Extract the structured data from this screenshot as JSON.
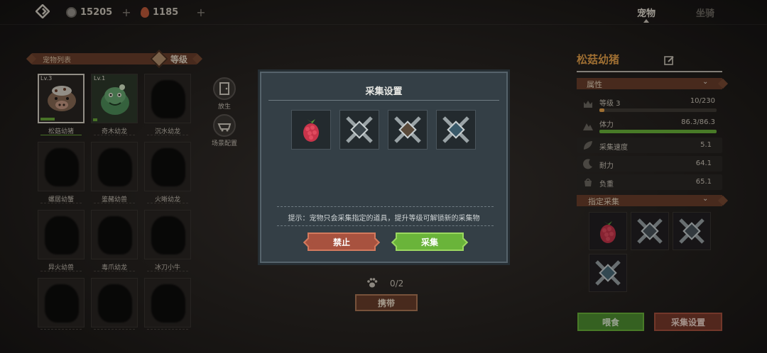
{
  "topbar": {
    "coins": "15205",
    "gems": "1185",
    "tabs": [
      {
        "label": "宠物",
        "active": true
      },
      {
        "label": "坐骑",
        "active": false
      }
    ]
  },
  "pet_list": {
    "title": "宠物列表",
    "sort_label": "等级",
    "pets": [
      {
        "name": "松菇幼猪",
        "level": "Lv.3",
        "selected": true,
        "known": true
      },
      {
        "name": "奇木幼龙",
        "level": "Lv.1",
        "selected": false,
        "known": true
      },
      {
        "name": "沉水幼龙",
        "level": "",
        "selected": false,
        "known": false
      },
      {
        "name": "螺居幼蟹",
        "level": "",
        "selected": false,
        "known": false
      },
      {
        "name": "鉴赭幼兽",
        "level": "",
        "selected": false,
        "known": false
      },
      {
        "name": "火晰幼龙",
        "level": "",
        "selected": false,
        "known": false
      },
      {
        "name": "异火幼兽",
        "level": "",
        "selected": false,
        "known": false
      },
      {
        "name": "毒爪幼龙",
        "level": "",
        "selected": false,
        "known": false
      },
      {
        "name": "冰刀小牛",
        "level": "",
        "selected": false,
        "known": false
      }
    ]
  },
  "side_buttons": {
    "release": "放生",
    "scene_config": "场景配置"
  },
  "modal": {
    "title": "采集设置",
    "items": [
      "raspberry-icon",
      "crossed-tools-icon",
      "crossed-tools-icon",
      "crossed-tools-icon"
    ],
    "hint": "提示：宠物只会采集指定的道具，提升等级可解锁新的采集物",
    "forbid_label": "禁止",
    "collect_label": "采集"
  },
  "carry": {
    "count": "0/2",
    "button_label": "携带"
  },
  "detail": {
    "pet_name": "松菇幼猪",
    "attr_header": "属性",
    "level_label": "等级 3",
    "level_exp": "10/230",
    "level_progress": 0.043,
    "stamina_label": "体力",
    "stamina_value": "86.3/86.3",
    "stamina_progress": 1.0,
    "stats": [
      {
        "label": "采集速度",
        "value": "5.1"
      },
      {
        "label": "耐力",
        "value": "64.1"
      },
      {
        "label": "负重",
        "value": "65.1"
      }
    ],
    "assign_header": "指定采集",
    "feed_label": "喂食",
    "gather_settings_label": "采集设置"
  },
  "colors": {
    "accent_orange": "#e8a24a",
    "green": "#6ab43a",
    "red": "#a8523f",
    "brown_header": "#6a3f2b"
  }
}
